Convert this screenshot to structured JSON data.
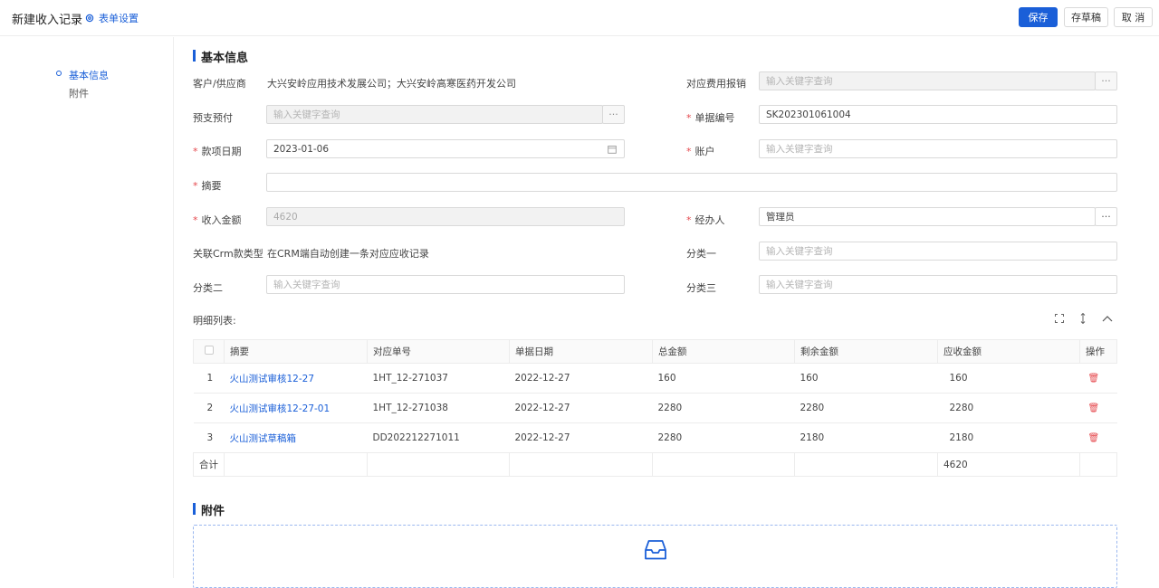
{
  "header": {
    "title": "新建收入记录",
    "form_setting": "表单设置",
    "save": "保存",
    "draft": "存草稿",
    "cancel": "取 消"
  },
  "nav": [
    {
      "label": "基本信息",
      "active": true
    },
    {
      "label": "附件",
      "active": false
    }
  ],
  "basic": {
    "section_title": "基本信息",
    "customer_label": "客户/供应商",
    "customer_value": "大兴安岭应用技术发展公司；大兴安岭高寒医药开发公司",
    "expense_label": "对应费用报销",
    "expense_placeholder": "输入关键字查询",
    "prepay_label": "预支预付",
    "prepay_placeholder": "输入关键字查询",
    "doc_no_label": "单据编号",
    "doc_no_value": "SK202301061004",
    "date_label": "款项日期",
    "date_value": "2023-01-06",
    "account_label": "账户",
    "account_placeholder": "输入关键字查询",
    "summary_label": "摘要",
    "summary_value": "",
    "amount_label": "收入金额",
    "amount_value": "4620",
    "handler_label": "经办人",
    "handler_value": "管理员",
    "crm_label": "关联Crm款类型",
    "crm_value": "在CRM端自动创建一条对应应收记录",
    "cat1_label": "分类一",
    "cat1_placeholder": "输入关键字查询",
    "cat2_label": "分类二",
    "cat2_placeholder": "输入关键字查询",
    "cat3_label": "分类三",
    "cat3_placeholder": "输入关键字查询",
    "ellipsis": "···"
  },
  "detail": {
    "title": "明细列表:",
    "columns": [
      "摘要",
      "对应单号",
      "单据日期",
      "总金额",
      "剩余金额",
      "应收金额",
      "操作"
    ],
    "rows": [
      {
        "idx": "1",
        "summary": "火山测试审核12-27",
        "ref": "1HT_12-271037",
        "date": "2022-12-27",
        "total": "160",
        "remain": "160",
        "receivable": "160"
      },
      {
        "idx": "2",
        "summary": "火山测试审核12-27-01",
        "ref": "1HT_12-271038",
        "date": "2022-12-27",
        "total": "2280",
        "remain": "2280",
        "receivable": "2280"
      },
      {
        "idx": "3",
        "summary": "火山测试草稿箱",
        "ref": "DD202212271011",
        "date": "2022-12-27",
        "total": "2280",
        "remain": "2180",
        "receivable": "2180"
      }
    ],
    "sum_label": "合计",
    "sum_receivable": "4620"
  },
  "attachment": {
    "section_title": "附件"
  },
  "colors": {
    "primary": "#1a5fd8",
    "danger": "#e5484d"
  }
}
